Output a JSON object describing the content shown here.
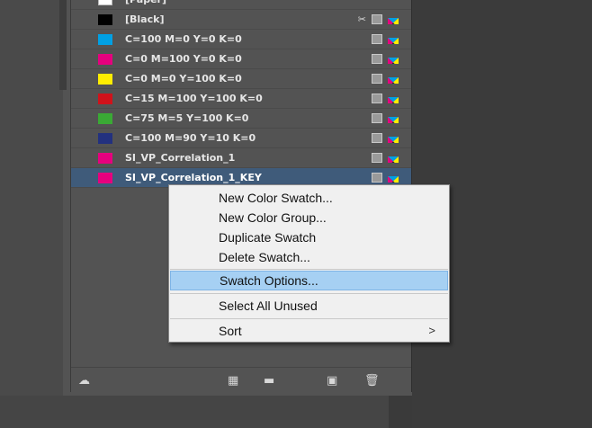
{
  "swatches": [
    {
      "name": "[Paper]",
      "color": "#ffffff",
      "icons": []
    },
    {
      "name": "[Black]",
      "color": "#000000",
      "icons": [
        "scissor-icon",
        "gray-box-icon",
        "cmyk-icon"
      ]
    },
    {
      "name": "C=100 M=0 Y=0 K=0",
      "color": "#00a0e3",
      "icons": [
        "gray-box-icon",
        "cmyk-icon"
      ]
    },
    {
      "name": "C=0 M=100 Y=0 K=0",
      "color": "#e6007e",
      "icons": [
        "gray-box-icon",
        "cmyk-icon"
      ]
    },
    {
      "name": "C=0 M=0 Y=100 K=0",
      "color": "#ffed00",
      "icons": [
        "gray-box-icon",
        "cmyk-icon"
      ]
    },
    {
      "name": "C=15 M=100 Y=100 K=0",
      "color": "#d0121b",
      "icons": [
        "gray-box-icon",
        "cmyk-icon"
      ]
    },
    {
      "name": "C=75 M=5 Y=100 K=0",
      "color": "#3aa935",
      "icons": [
        "gray-box-icon",
        "cmyk-icon"
      ]
    },
    {
      "name": "C=100 M=90 Y=10 K=0",
      "color": "#23317f",
      "icons": [
        "gray-box-icon",
        "cmyk-icon"
      ]
    },
    {
      "name": "SI_VP_Correlation_1",
      "color": "#e6007e",
      "icons": [
        "gray-box-icon",
        "cmyk-icon"
      ]
    },
    {
      "name": "SI_VP_Correlation_1_KEY",
      "color": "#e6007e",
      "icons": [
        "gray-box-icon",
        "cmyk-icon"
      ],
      "selected": true
    }
  ],
  "context_menu": {
    "items": [
      {
        "label": "New Color Swatch..."
      },
      {
        "label": "New Color Group..."
      },
      {
        "label": "Duplicate Swatch"
      },
      {
        "label": "Delete Swatch..."
      },
      {
        "label": "Swatch Options...",
        "highlighted": true
      },
      {
        "label": "Select All Unused"
      },
      {
        "label": "Sort",
        "submenu_arrow": ">"
      }
    ]
  },
  "footer_icons": [
    "cc-library-icon",
    "swatch-view-icon",
    "folder-icon",
    "new-swatch-icon",
    "trash-icon"
  ],
  "colors": {
    "panel_bg": "#535353",
    "selected_row": "#3f5b7a",
    "menu_highlight": "#a6d0f3"
  }
}
